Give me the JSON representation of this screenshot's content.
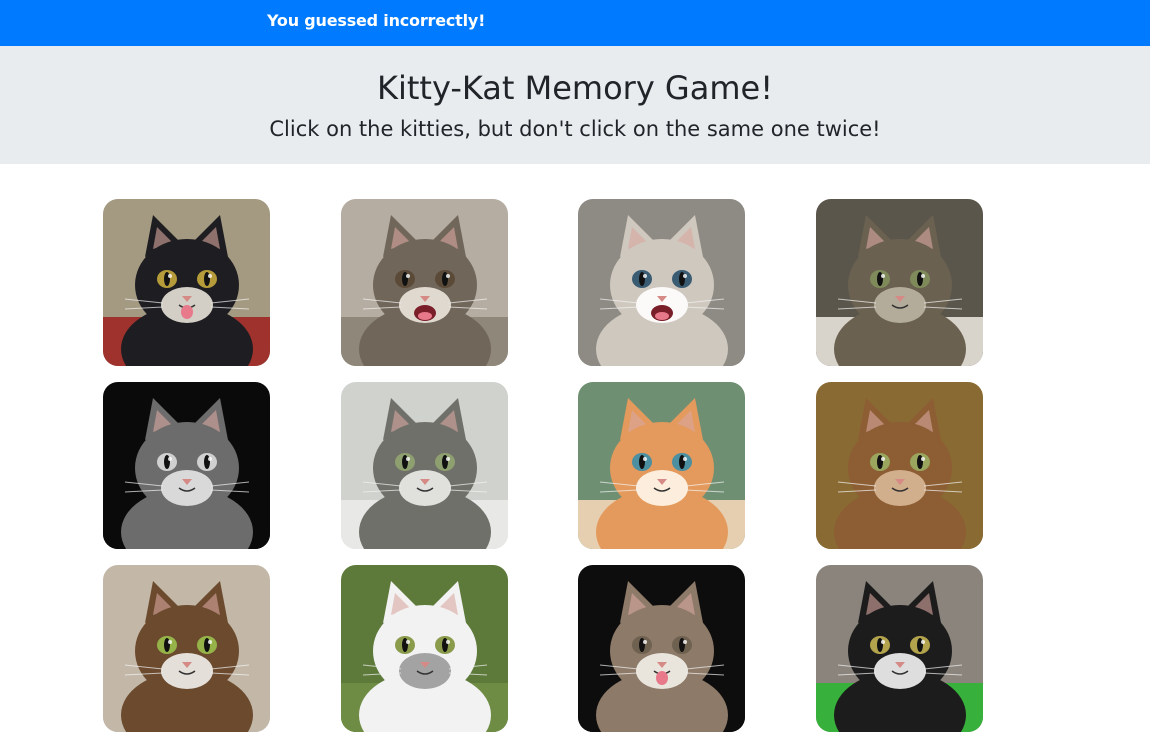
{
  "header": {
    "message": "You guessed incorrectly!"
  },
  "banner": {
    "title": "Kitty-Kat Memory Game!",
    "subtitle": "Click on the kitties, but don't click on the same one twice!"
  },
  "cats": [
    {
      "name": "wet-black-cat-tongue",
      "bg": "#a49a82",
      "floor": "#a0322e",
      "fur": "#1e1e22",
      "accent": "#e7e2d8",
      "eye": "#b59b3a",
      "tongue": true
    },
    {
      "name": "yawning-tabby-lying",
      "bg": "#b5ada2",
      "floor": "#8f8779",
      "fur": "#70665a",
      "accent": "#ece6dc",
      "eye": "#5b4a38",
      "yawn": true
    },
    {
      "name": "wide-eyed-kitten-meowing",
      "bg": "#8e8a84",
      "floor": "#8e8a84",
      "fur": "#cfc8bf",
      "accent": "#ffffff",
      "eye": "#3a5c73",
      "yawn": true
    },
    {
      "name": "tabby-cat-lying",
      "bg": "#5a564c",
      "floor": "#d8d4cc",
      "fur": "#6b6150",
      "accent": "#bdb5a3",
      "eye": "#7e8a5a"
    },
    {
      "name": "black-white-cat-closeup",
      "bg": "#0a0a0a",
      "floor": "#0a0a0a",
      "fur": "#6c6c6c",
      "accent": "#e6e6e6",
      "eye": "#d0d0d0"
    },
    {
      "name": "tabby-kitten-upside-down",
      "bg": "#d0d2ce",
      "floor": "#e8e8e6",
      "fur": "#6f7069",
      "accent": "#ececea",
      "eye": "#8fa070"
    },
    {
      "name": "orange-kitten",
      "bg": "#6f8f72",
      "floor": "#e6cfb0",
      "fur": "#e49a5c",
      "accent": "#fff6ea",
      "eye": "#4b8fa1"
    },
    {
      "name": "brown-tabby-closeup",
      "bg": "#8a6a33",
      "floor": "#8a6a33",
      "fur": "#8d5d34",
      "accent": "#d9b896",
      "eye": "#9aa55e"
    },
    {
      "name": "maine-coon-portrait",
      "bg": "#c3b8a8",
      "floor": "#c3b8a8",
      "fur": "#6b4a2e",
      "accent": "#f2f0ec",
      "eye": "#96b34a"
    },
    {
      "name": "white-cat-collar",
      "bg": "#5d7a3a",
      "floor": "#6f8c45",
      "fur": "#f2f2f2",
      "accent": "#9a9a9a",
      "eye": "#8b9b4c"
    },
    {
      "name": "tabby-white-tongue",
      "bg": "#0d0d0d",
      "floor": "#0d0d0d",
      "fur": "#8d7a68",
      "accent": "#f3efe9",
      "eye": "#6f6150",
      "tongue": true
    },
    {
      "name": "tuxedo-cat-green-blanket",
      "bg": "#8a847c",
      "floor": "#37b13c",
      "fur": "#1c1c1c",
      "accent": "#f4f4f4",
      "eye": "#b2a34c"
    }
  ]
}
